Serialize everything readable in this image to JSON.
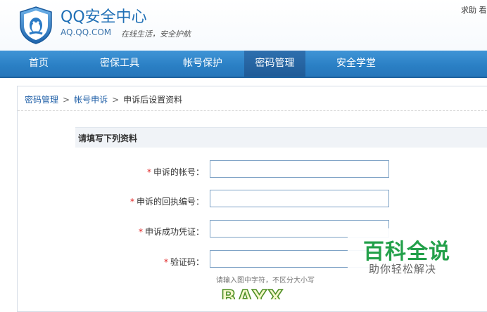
{
  "header": {
    "title": "QQ安全中心",
    "domain": "AQ.QQ.COM",
    "slogan": "在线生活，安全护航",
    "top_links": "求助  看"
  },
  "nav": {
    "items": [
      {
        "label": "首页"
      },
      {
        "label": "密保工具"
      },
      {
        "label": "帐号保护"
      },
      {
        "label": "密码管理",
        "active": true
      },
      {
        "label": "安全学堂"
      }
    ]
  },
  "breadcrumb": {
    "items": [
      "密码管理",
      "帐号申诉",
      "申诉后设置资料"
    ],
    "separator": ">"
  },
  "form": {
    "section_title": "请填写下列资料",
    "required_mark": "*",
    "fields": [
      {
        "label": "申诉的帐号：",
        "value": ""
      },
      {
        "label": "申诉的回执编号：",
        "value": ""
      },
      {
        "label": "申诉成功凭证：",
        "value": ""
      },
      {
        "label": "验证码：",
        "value": ""
      }
    ],
    "captcha_hint": "请输入图中字符，不区分大小写",
    "captcha_text": "BAYX"
  },
  "watermark": {
    "title": "百科全说",
    "subtitle": "助你轻松解决"
  },
  "colors": {
    "nav_bg": "#2a7fc4",
    "nav_active": "#1f5b97",
    "brand_blue": "#1f6fb5",
    "required": "#e02020",
    "watermark_green": "#23a04a"
  }
}
